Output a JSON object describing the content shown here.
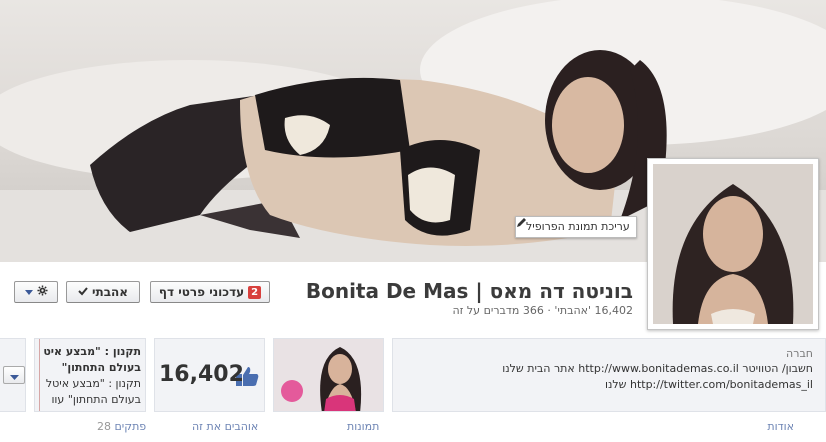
{
  "cover": {
    "edit_profile_picture": "עריכת תמונת הפרופיל"
  },
  "header": {
    "page_name": "Bonita De Mas | בוניטה דה מאס",
    "stats": "16,402 'אהבתי' · 366 מדברים על זה"
  },
  "buttons": {
    "updates_label": "עדכוני פרטי דף",
    "updates_count": "2",
    "liked_label": "אהבתי",
    "liked_icon": "check-icon",
    "settings_icon": "gear-icon"
  },
  "about": {
    "category": "חברה",
    "line1": "אתר הבית שלנו http://www.bonitademas.co.il חשבון/ הטוויטר",
    "line2": "שלנו http://twitter.com/bonitademas_il",
    "tab_label": "אודות"
  },
  "photos": {
    "tab_label": "תמונות"
  },
  "likes": {
    "count": "16,402",
    "tab_label": "אוהבים את זה"
  },
  "apps": {
    "line1": "תקנון : \"מבצע איט",
    "line2": "בעולם התחתון\"",
    "line3": "תקנון : \"מבצע איטל",
    "line4": "בעולם התחתון\" עוו",
    "tab_label": "פתקים",
    "tab_count": "28"
  },
  "colors": {
    "link": "#6d84b4",
    "badge": "#d8403d",
    "like_thumb": "#4a6eb0"
  }
}
